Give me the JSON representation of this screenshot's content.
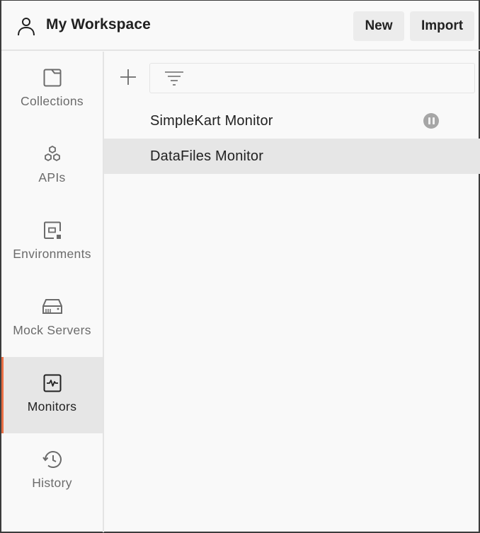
{
  "header": {
    "workspace_icon": "user-icon",
    "workspace_title": "My Workspace",
    "new_label": "New",
    "import_label": "Import"
  },
  "sidebar": {
    "items": [
      {
        "label": "Collections",
        "icon": "collections-icon",
        "active": false
      },
      {
        "label": "APIs",
        "icon": "apis-icon",
        "active": false
      },
      {
        "label": "Environments",
        "icon": "environments-icon",
        "active": false
      },
      {
        "label": "Mock Servers",
        "icon": "mock-servers-icon",
        "active": false
      },
      {
        "label": "Monitors",
        "icon": "monitors-icon",
        "active": true
      },
      {
        "label": "History",
        "icon": "history-icon",
        "active": false
      }
    ],
    "accent_color": "#e86f45"
  },
  "main": {
    "add_icon": "plus-icon",
    "filter_icon": "filter-icon",
    "filter_value": "",
    "filter_placeholder": "",
    "monitors": [
      {
        "name": "SimpleKart Monitor",
        "status": "paused",
        "selected": false
      },
      {
        "name": "DataFiles Monitor",
        "status": "",
        "selected": true
      }
    ]
  }
}
